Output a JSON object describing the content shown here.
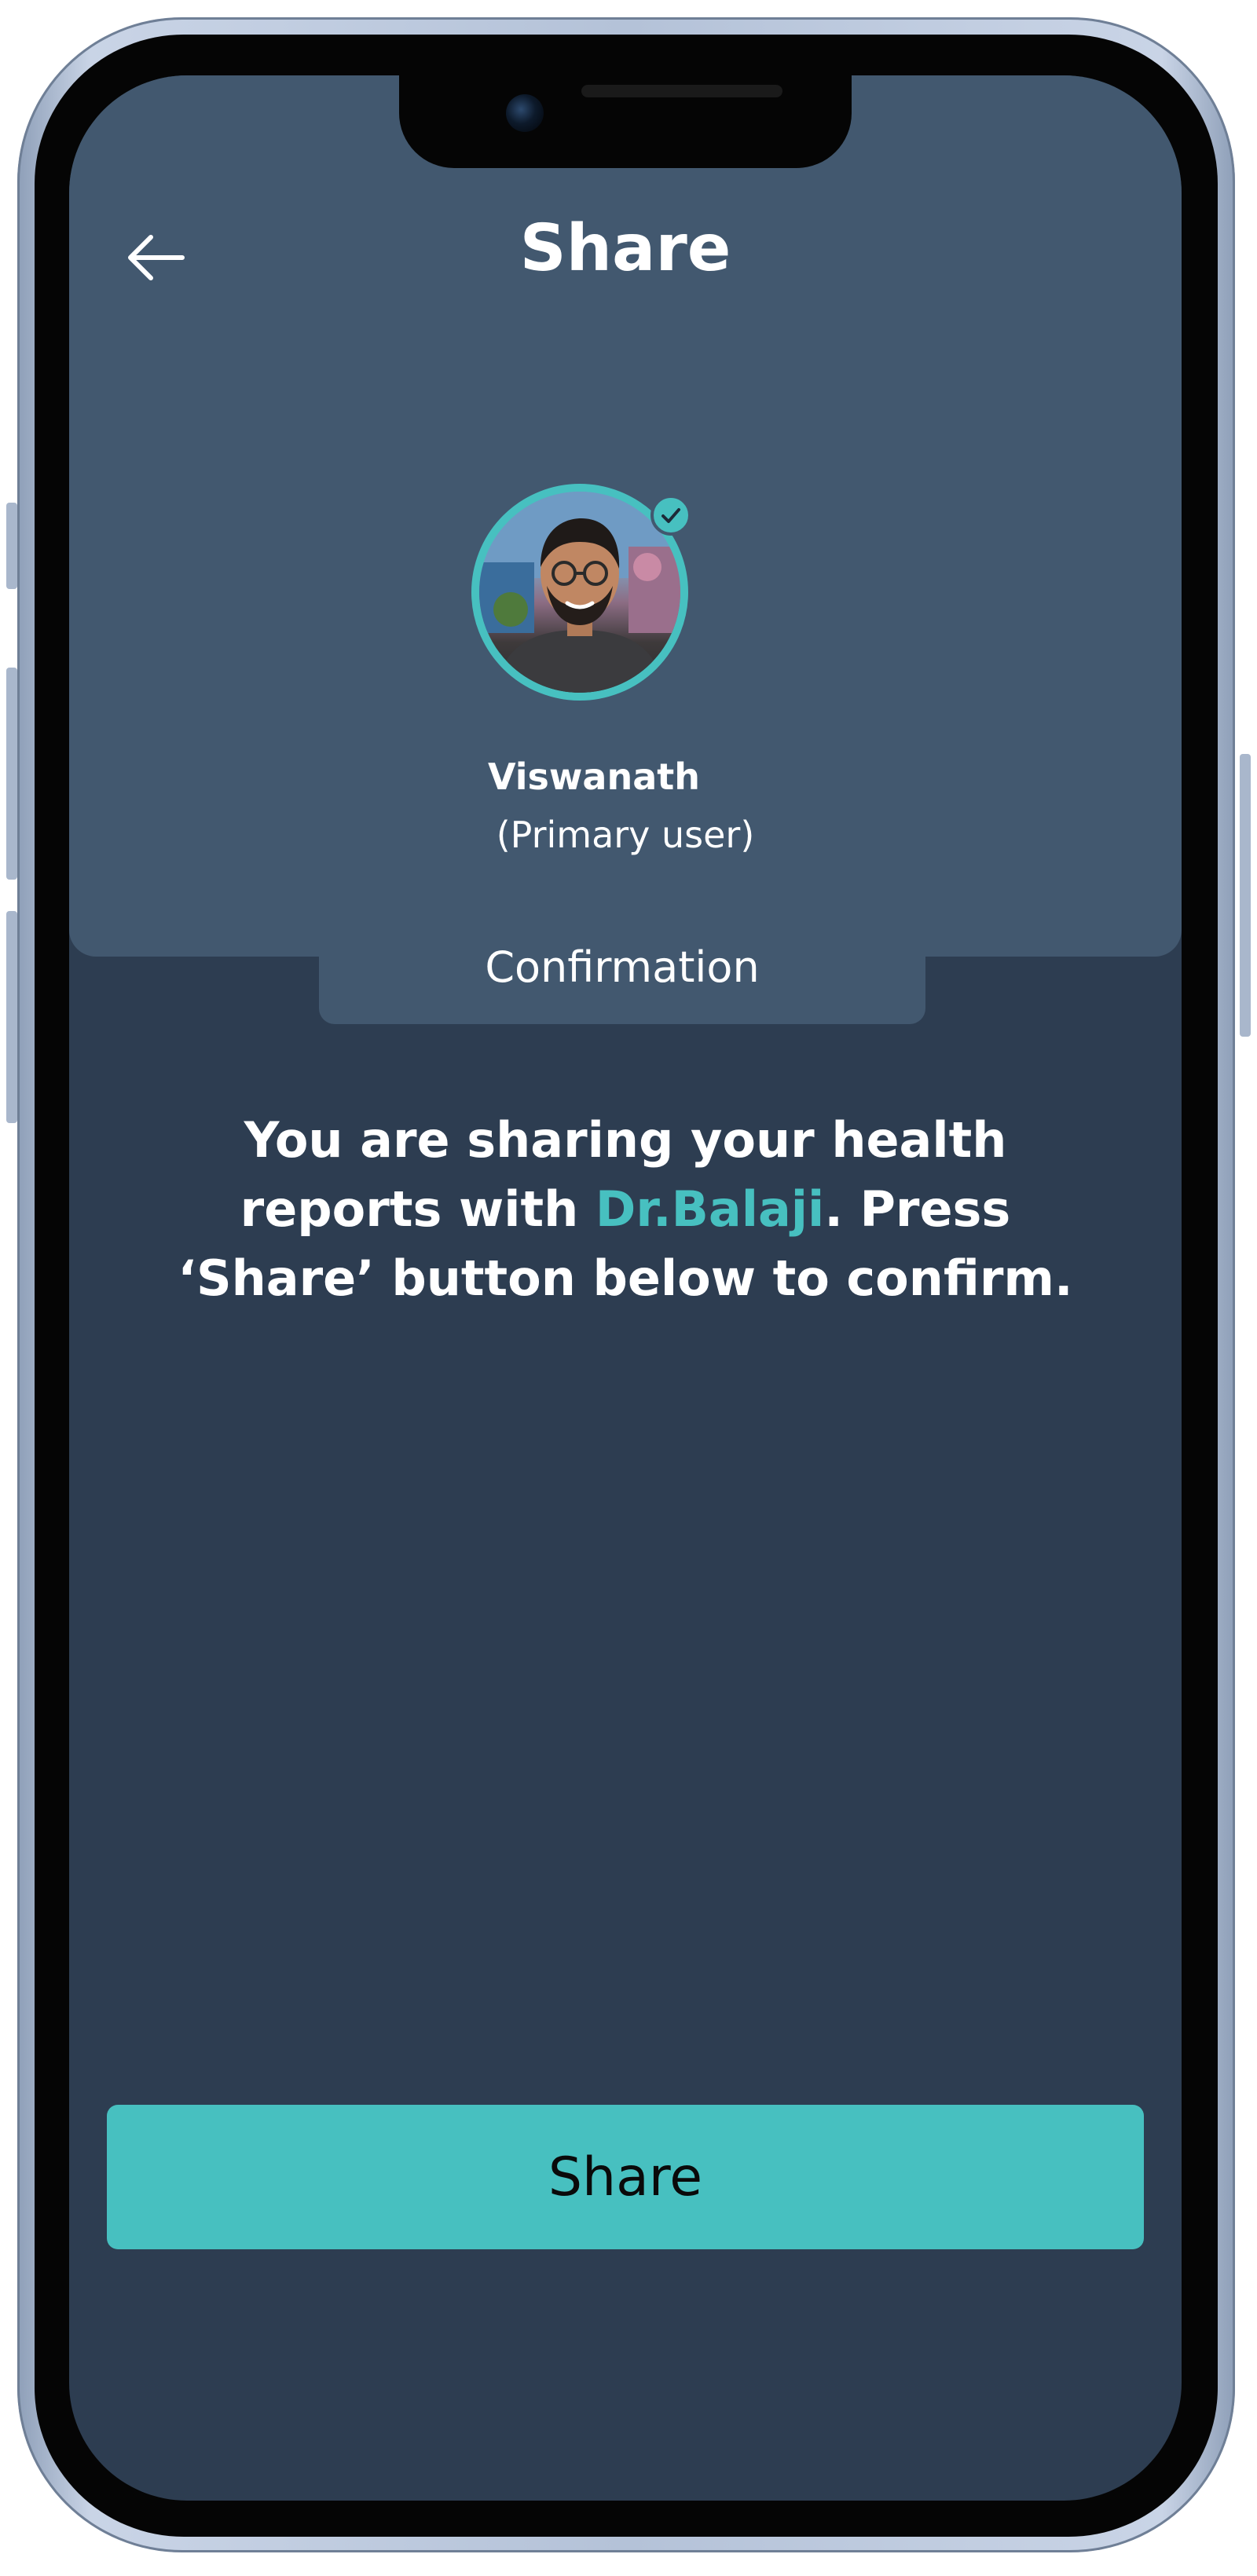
{
  "header": {
    "title": "Share",
    "back_icon": "arrow-left-icon"
  },
  "profile": {
    "name": "Viswanath",
    "role": "(Primary user)",
    "verified_icon": "check-badge-icon"
  },
  "confirmation_tab": {
    "label": "Confirmation"
  },
  "message": {
    "before": "You are sharing your health reports with ",
    "doctor": "Dr.Balaji",
    "after": ". Press ‘Share’ button below to confirm."
  },
  "share_button": {
    "label": "Share"
  },
  "colors": {
    "accent": "#47c0c0",
    "header_bg": "#42586f",
    "screen_bg": "#2d3d51"
  }
}
